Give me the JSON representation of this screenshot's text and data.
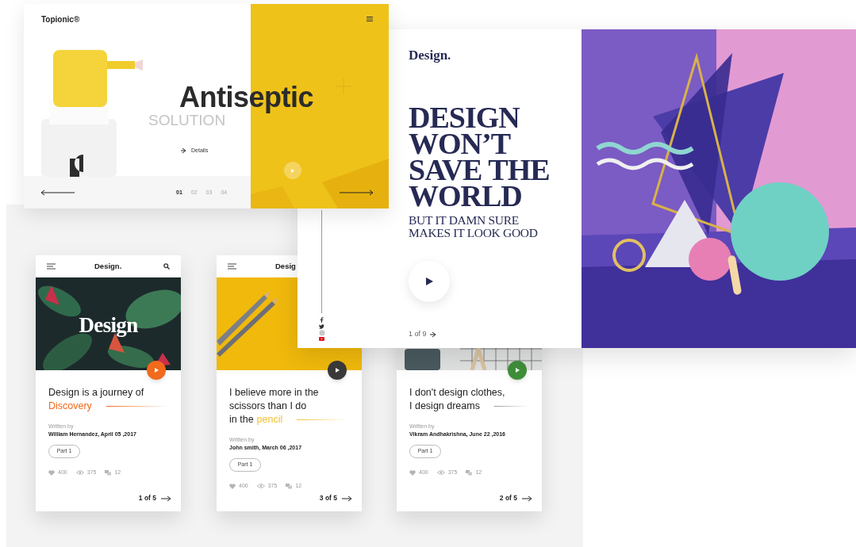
{
  "product_page": {
    "brand": "Topionic®",
    "headline": "Antiseptic",
    "subheadline": "SOLUTION",
    "details_link": "Details",
    "pages": [
      {
        "label": "01",
        "selected": true
      },
      {
        "label": "02",
        "selected": false
      },
      {
        "label": "03",
        "selected": false
      },
      {
        "label": "04",
        "selected": false
      }
    ]
  },
  "design_page": {
    "logo": "Design.",
    "headline_lines": [
      "DESIGN",
      "WON’T",
      "SAVE THE",
      "WORLD"
    ],
    "subheadline_lines": [
      "BUT IT DAMN SURE",
      "MAKES IT LOOK GOOD"
    ],
    "pager": "1 of 9",
    "social": [
      {
        "kind": "facebook"
      },
      {
        "kind": "twitter"
      },
      {
        "kind": "instagram"
      },
      {
        "kind": "youtube"
      }
    ]
  },
  "cards": [
    {
      "kind": "foliage",
      "image_text": "Design",
      "header": {
        "title": "Design.",
        "search": true
      },
      "title_lines": [
        {
          "text": "Design is a journey of"
        },
        {
          "highlight": "Discovery"
        }
      ],
      "written_by": "Written by",
      "author": "William Hernandez, April 05 ,2017",
      "part": "Part 1",
      "stats": [
        {
          "kind": "likes",
          "count": "400"
        },
        {
          "kind": "views",
          "count": "375"
        },
        {
          "kind": "comments",
          "count": "12"
        }
      ],
      "pager": "1 of 5"
    },
    {
      "kind": "pencils",
      "header": {
        "title": "Desig",
        "search": false
      },
      "title_lines": [
        {
          "text": "I believe more in the"
        },
        {
          "text": "scissors than I do"
        },
        {
          "text": "in the",
          "highlight": "pencil"
        }
      ],
      "written_by": "Written by",
      "author": "John smith,  March 06 ,2017",
      "part": "Part 1",
      "stats": [
        {
          "kind": "likes",
          "count": "400"
        },
        {
          "kind": "views",
          "count": "375"
        },
        {
          "kind": "comments",
          "count": "12"
        }
      ],
      "pager": "3 of 5"
    },
    {
      "kind": "shelf",
      "title_lines": [
        {
          "text": "I don't design clothes,"
        },
        {
          "text": "I design dreams"
        }
      ],
      "written_by": "Written by",
      "author": "Vikram Andhakrishna,  June 22 ,2016",
      "part": "Part 1",
      "stats": [
        {
          "kind": "likes",
          "count": "400"
        },
        {
          "kind": "views",
          "count": "375"
        },
        {
          "kind": "comments",
          "count": "12"
        }
      ],
      "pager": "2 of 5"
    }
  ]
}
